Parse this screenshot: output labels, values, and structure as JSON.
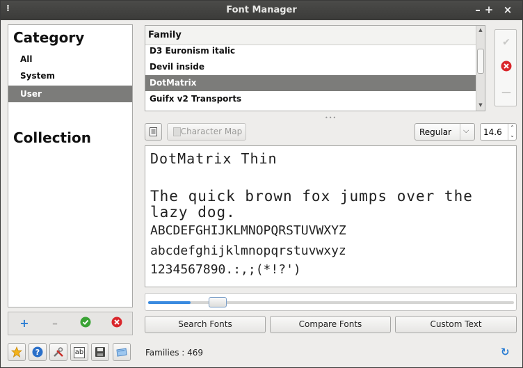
{
  "window": {
    "title": "Font Manager",
    "menu_glyph": "⁞",
    "minimize": "–",
    "maximize": "+",
    "close": "×"
  },
  "sidebar": {
    "category_title": "Category",
    "categories": [
      {
        "label": "All"
      },
      {
        "label": "System"
      },
      {
        "label": "User",
        "selected": true
      }
    ],
    "collection_title": "Collection",
    "toolbar": {
      "add": "+",
      "remove": "–",
      "enable": "✔",
      "disable": "✖"
    }
  },
  "family_list": {
    "header": "Family",
    "rows": [
      {
        "label": "D3 Euronism italic"
      },
      {
        "label": "Devil inside"
      },
      {
        "label": "DotMatrix",
        "selected": true
      },
      {
        "label": "Guifx v2 Transports"
      }
    ]
  },
  "family_actions": {
    "enable": "✔",
    "disable": "✖",
    "remove": "—"
  },
  "controls": {
    "character_map": "Character Map",
    "style": "Regular",
    "size": "14.6"
  },
  "preview": {
    "name_line": "DotMatrix Thin",
    "sample_line1": "The quick brown fox jumps over the",
    "sample_line2": "lazy dog.",
    "uppercase": "ABCDEFGHIJKLMNOPQRSTUVWXYZ",
    "lowercase": "abcdefghijklmnopqrstuvwxyz",
    "digits": "1234567890.:,;(*!?')"
  },
  "preview_size_slider": {
    "level": 0.1
  },
  "actions": {
    "search_fonts": "Search Fonts",
    "compare_fonts": "Compare Fonts",
    "custom_text": "Custom Text"
  },
  "status": {
    "families": "Families : 469"
  },
  "colors": {
    "accent": "#3a8be0",
    "selection": "#7c7c7a",
    "enable": "#3aa335",
    "disable": "#d9262b"
  }
}
